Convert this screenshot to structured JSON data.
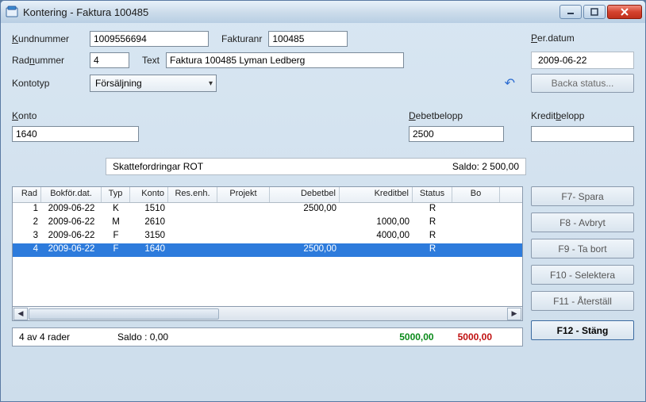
{
  "window": {
    "title": "Kontering - Faktura 100485"
  },
  "labels": {
    "kundnummer": "Kundnummer",
    "fakturanr": "Fakturanr",
    "radnummer": "Radnummer",
    "text": "Text",
    "kontotyp": "Kontotyp",
    "perdatum": "Per.datum",
    "backa": "Backa status...",
    "konto": "Konto",
    "debetbelopp": "Debetbelopp",
    "kreditbelopp": "Kreditbelopp"
  },
  "fields": {
    "kundnummer": "1009556694",
    "fakturanr": "100485",
    "radnummer": "4",
    "text": "Faktura 100485 Lyman Ledberg",
    "kontotyp": "Försäljning",
    "perdatum": "2009-06-22",
    "konto": "1640",
    "debetbelopp": "2500",
    "kreditbelopp": ""
  },
  "summary": {
    "kontoName": "Skattefordringar ROT",
    "saldoLabel": "Saldo: 2 500,00"
  },
  "grid": {
    "headers": {
      "rad": "Rad",
      "bokfor": "Bokför.dat.",
      "typ": "Typ",
      "konto": "Konto",
      "resenh": "Res.enh.",
      "projekt": "Projekt",
      "debet": "Debetbel",
      "kredit": "Kreditbel",
      "status": "Status",
      "bo": "Bo"
    },
    "rows": [
      {
        "rad": "1",
        "dat": "2009-06-22",
        "typ": "K",
        "konto": "1510",
        "res": "",
        "proj": "",
        "deb": "2500,00",
        "kred": "",
        "stat": "R"
      },
      {
        "rad": "2",
        "dat": "2009-06-22",
        "typ": "M",
        "konto": "2610",
        "res": "",
        "proj": "",
        "deb": "",
        "kred": "1000,00",
        "stat": "R"
      },
      {
        "rad": "3",
        "dat": "2009-06-22",
        "typ": "F",
        "konto": "3150",
        "res": "",
        "proj": "",
        "deb": "",
        "kred": "4000,00",
        "stat": "R"
      },
      {
        "rad": "4",
        "dat": "2009-06-22",
        "typ": "F",
        "konto": "1640",
        "res": "",
        "proj": "",
        "deb": "2500,00",
        "kred": "",
        "stat": "R"
      }
    ],
    "selectedIndex": 3
  },
  "footer": {
    "count": "4 av 4 rader",
    "saldo": "Saldo : 0,00",
    "sumDebet": "5000,00",
    "sumKredit": "5000,00"
  },
  "buttons": {
    "f7": "F7- Spara",
    "f8": "F8 - Avbryt",
    "f9": "F9 - Ta bort",
    "f10": "F10 - Selektera",
    "f11": "F11 - Återställ",
    "f12": "F12 - Stäng"
  }
}
